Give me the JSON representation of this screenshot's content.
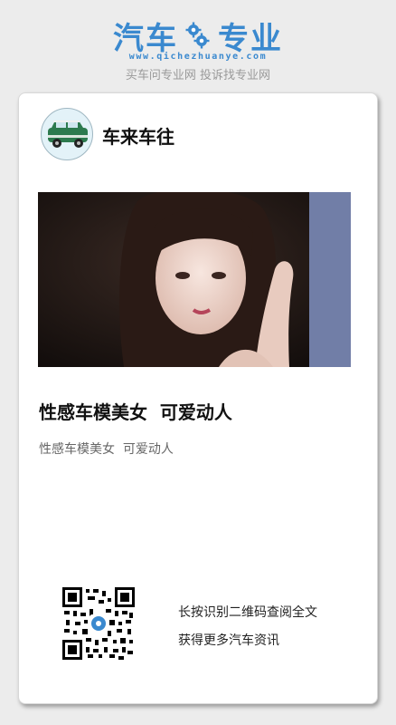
{
  "brand": {
    "logo_left": "汽车",
    "logo_right": "专业",
    "url": "www.qichezhuanye.com",
    "slogan": "买车问专业网 投诉找专业网",
    "color": "#3a89cf"
  },
  "card": {
    "author_name": "车来车往",
    "avatar_icon": "green-car-icon",
    "title": "性感车模美女  可爱动人",
    "summary": "性感车模美女  可爱动人",
    "qr": {
      "line1": "长按识别二维码查阅全文",
      "line2": "获得更多汽车资讯"
    }
  }
}
